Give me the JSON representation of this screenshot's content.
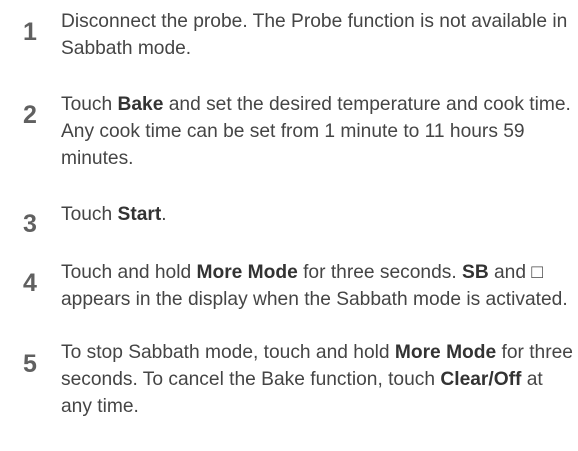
{
  "steps": [
    {
      "number": "1",
      "parts": [
        {
          "text": "Disconnect the probe. The Probe function is not available in Sabbath mode.",
          "bold": false
        }
      ]
    },
    {
      "number": "2",
      "parts": [
        {
          "text": "Touch ",
          "bold": false
        },
        {
          "text": "Bake",
          "bold": true
        },
        {
          "text": " and set the desired temperature and cook time. Any cook time can be set from 1 minute to 11 hours 59 minutes.",
          "bold": false
        }
      ]
    },
    {
      "number": "3",
      "parts": [
        {
          "text": "Touch ",
          "bold": false
        },
        {
          "text": "Start",
          "bold": true
        },
        {
          "text": ".",
          "bold": false
        }
      ]
    },
    {
      "number": "4",
      "parts": [
        {
          "text": "Touch and hold ",
          "bold": false
        },
        {
          "text": "More Mode",
          "bold": true
        },
        {
          "text": " for three seconds. ",
          "bold": false
        },
        {
          "text": "SB",
          "bold": true
        },
        {
          "text": " and □ appears in the display when the Sabbath mode is activated.",
          "bold": false
        }
      ]
    },
    {
      "number": "5",
      "parts": [
        {
          "text": "To stop Sabbath mode, touch and hold ",
          "bold": false
        },
        {
          "text": "More Mode",
          "bold": true
        },
        {
          "text": " for three seconds. To cancel the Bake function, touch ",
          "bold": false
        },
        {
          "text": "Clear/Off",
          "bold": true
        },
        {
          "text": " at any time.",
          "bold": false
        }
      ]
    }
  ]
}
